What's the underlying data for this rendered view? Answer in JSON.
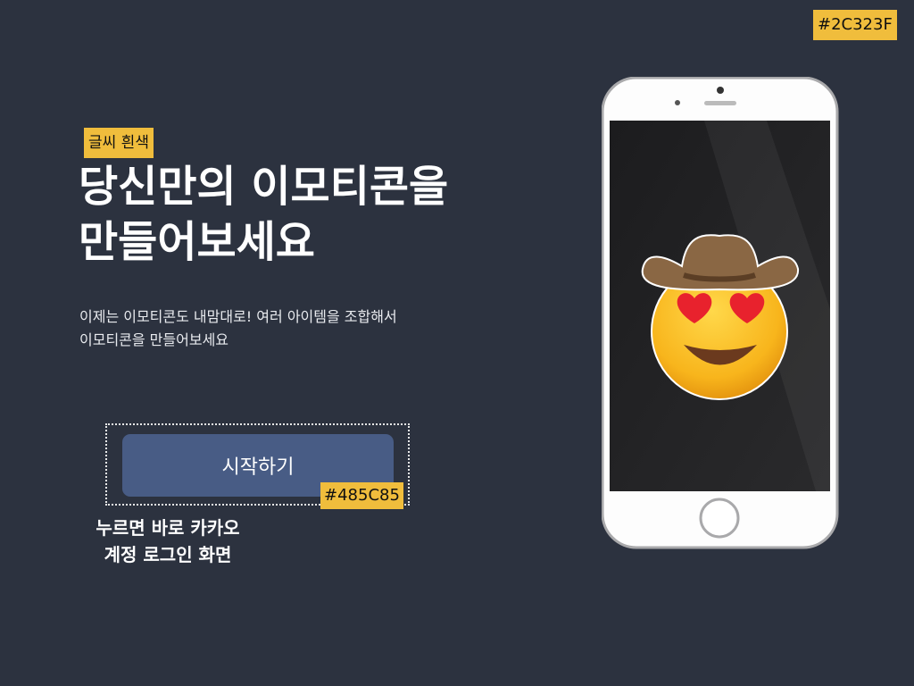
{
  "annotations": {
    "background_color_label": "#2C323F",
    "text_color_note": "글씨 흰색",
    "button_color_label": "#485C85",
    "button_action_note": "누르면 바로 카카오 계정 로그인 화면"
  },
  "hero": {
    "title_line1": "당신만의 이모티콘을",
    "title_line2": "만들어보세요",
    "description_line1": "이제는 이모티콘도 내맘대로! 여러 아이템을 조합해서",
    "description_line2": "이모티콘을 만들어보세요",
    "start_button_label": "시작하기"
  },
  "caption": {
    "line1": "누르면 바로 카카오",
    "line2": "계정 로그인 화면"
  },
  "colors": {
    "background": "#2C323F",
    "button": "#485C85",
    "annotation": "#F0BD3C"
  },
  "phone": {
    "screen_content": "cowboy-heart-eyes-emoji"
  }
}
